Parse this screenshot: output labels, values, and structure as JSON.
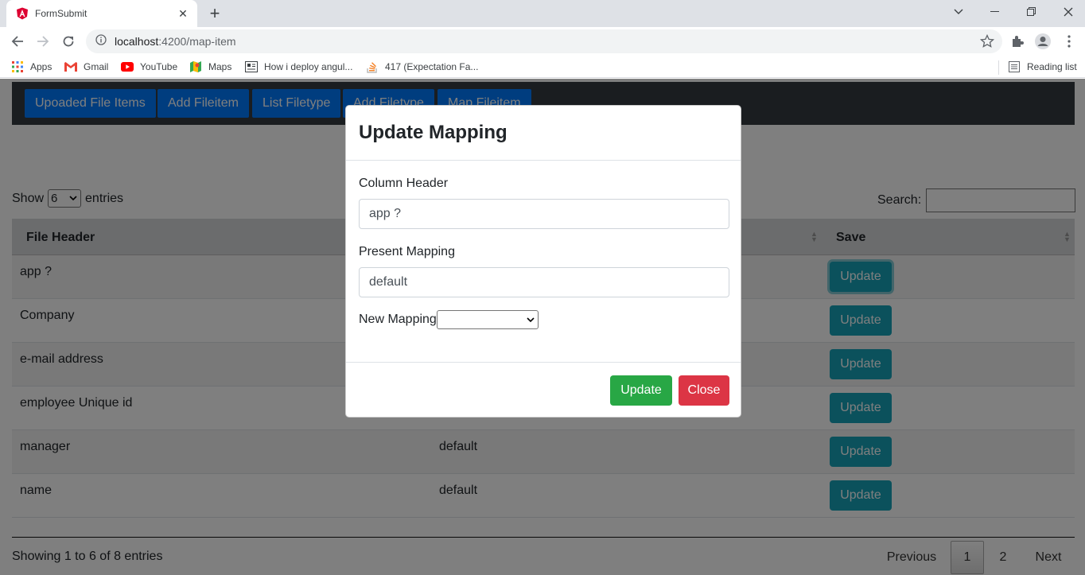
{
  "browser": {
    "tab_title": "FormSubmit",
    "url_host": "localhost",
    "url_rest": ":4200/map-item",
    "bookmarks": [
      {
        "label": "Apps",
        "icon": "apps-grid-icon"
      },
      {
        "label": "Gmail",
        "icon": "gmail-icon"
      },
      {
        "label": "YouTube",
        "icon": "youtube-icon"
      },
      {
        "label": "Maps",
        "icon": "maps-icon"
      },
      {
        "label": "How i deploy angul...",
        "icon": "page-icon"
      },
      {
        "label": "417 (Expectation Fa...",
        "icon": "stackoverflow-icon"
      }
    ],
    "reading_list": "Reading list"
  },
  "nav": {
    "buttons": [
      "Upoaded File Items",
      "Add Fileitem",
      "List Filetype",
      "Add Filetype",
      "Map Fileitem"
    ]
  },
  "table_controls": {
    "show": "Show",
    "length_value": "6",
    "entries": "entries",
    "search_label": "Search:"
  },
  "table": {
    "headers": [
      "File Header",
      "Save"
    ],
    "rows": [
      {
        "file_header": "app ?",
        "mapping": "",
        "button": "Update"
      },
      {
        "file_header": "Company",
        "mapping": "",
        "button": "Update"
      },
      {
        "file_header": "e-mail address",
        "mapping": "",
        "button": "Update"
      },
      {
        "file_header": "employee Unique id",
        "mapping": "",
        "button": "Update"
      },
      {
        "file_header": "manager",
        "mapping": "default",
        "button": "Update"
      },
      {
        "file_header": "name",
        "mapping": "default",
        "button": "Update"
      }
    ],
    "info": "Showing 1 to 6 of 8 entries",
    "pagination": {
      "previous": "Previous",
      "pages": [
        "1",
        "2"
      ],
      "next": "Next"
    }
  },
  "modal": {
    "title": "Update Mapping",
    "column_header_label": "Column Header",
    "column_header_value": "app ?",
    "present_mapping_label": "Present Mapping",
    "present_mapping_value": "default",
    "new_mapping_label": "New Mapping",
    "new_mapping_value": "",
    "update_button": "Update",
    "close_button": "Close"
  },
  "colors": {
    "nav_bg": "#343a40",
    "nav_btn": "#007bff",
    "update_row_btn": "#17a2b8",
    "modal_update": "#28a745",
    "modal_close": "#dc3545"
  }
}
